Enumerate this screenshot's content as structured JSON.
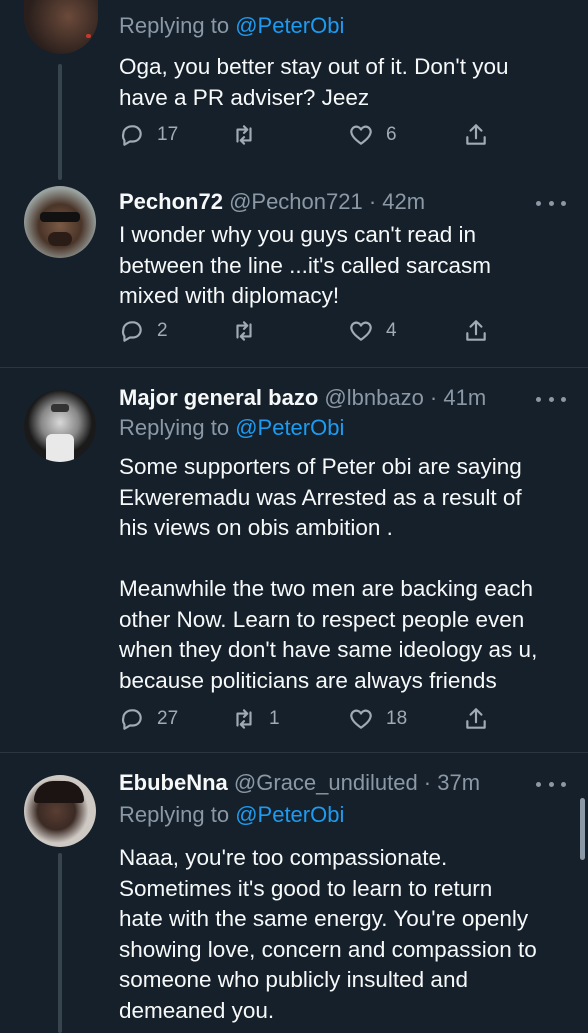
{
  "tweets": [
    {
      "reply_prefix": "Replying to",
      "reply_handle": "@PeterObi",
      "lines": [
        "Oga, you better stay out of it. Don't you",
        "have a PR adviser? Jeez"
      ],
      "replies": "17",
      "retweets": "",
      "likes": "6"
    },
    {
      "name": "Pechon72",
      "handle_time": "@Pechon721 · 42m",
      "lines": [
        "I wonder why you guys can't read in",
        "between the line ...it's called sarcasm",
        "mixed with diplomacy!"
      ],
      "replies": "2",
      "retweets": "",
      "likes": "4"
    },
    {
      "name": "Major general bazo",
      "handle_time": "@lbnbazo · 41m",
      "reply_prefix": "Replying to",
      "reply_handle": "@PeterObi",
      "lines": [
        "Some supporters of Peter obi are saying",
        "Ekweremadu was Arrested as a result of",
        "his views on obis ambition .",
        "",
        "Meanwhile the two men are backing each",
        "other Now. Learn to respect people even",
        "when they don't have same ideology as u,",
        "because politicians are always friends"
      ],
      "replies": "27",
      "retweets": "1",
      "likes": "18"
    },
    {
      "name": "EbubeNna",
      "handle_time": "@Grace_undiluted · 37m",
      "reply_prefix": "Replying to",
      "reply_handle": "@PeterObi",
      "lines": [
        "Naaa, you're too compassionate.",
        "Sometimes it's good to learn to return",
        "hate with the same energy. You're openly",
        "showing love, concern and compassion to",
        "someone who publicly insulted and",
        "demeaned you."
      ]
    }
  ],
  "icons": {
    "reply": "reply-icon",
    "retweet": "retweet-icon",
    "like": "heart-icon",
    "share": "share-icon",
    "more": "more-options-icon"
  },
  "colors": {
    "background": "#15202b",
    "link": "#1d9bf0",
    "muted": "#8b98a5",
    "divider": "#2c3640"
  }
}
